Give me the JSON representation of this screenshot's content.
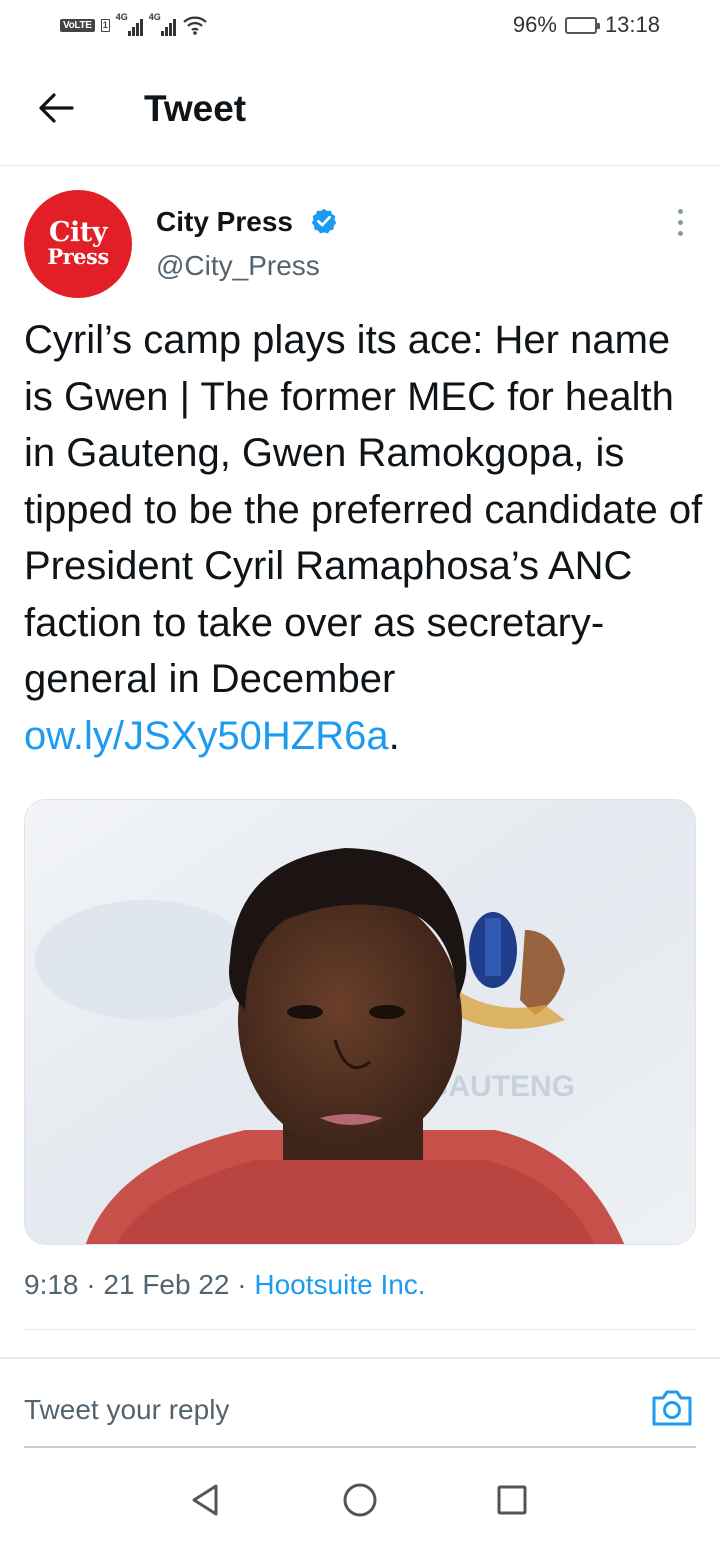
{
  "status_bar": {
    "volte": "VoLTE",
    "sim": "1",
    "network1": "4G",
    "network2": "4G",
    "battery_percent": "96%",
    "battery_level": 0.96,
    "time": "13:18",
    "icons": [
      "signal-icon",
      "signal-icon",
      "wifi-icon",
      "battery-icon"
    ]
  },
  "header": {
    "title": "Tweet",
    "back_icon": "arrow-left-icon"
  },
  "tweet": {
    "author": {
      "name": "City Press",
      "handle": "@City_Press",
      "avatar_line1": "City",
      "avatar_line2": "Press",
      "verified": true
    },
    "text": "Cyril’s camp plays its ace: Her name is Gwen | The former MEC for health in Gauteng, Gwen Ramokgopa, is tipped to be the preferred candidate of President Cyril Ramaphosa’s ANC faction to take over as secretary-general in December ",
    "link": "ow.ly/JSXy50HZR6a",
    "text_end": ".",
    "time": "9:18",
    "separator": "·",
    "date": "21 Feb 22",
    "source": "Hootsuite Inc."
  },
  "reply": {
    "placeholder": "Tweet your reply",
    "camera_icon": "camera-icon"
  },
  "nav": {
    "icons": [
      "back-triangle-icon",
      "home-circle-icon",
      "recents-square-icon"
    ]
  },
  "colors": {
    "link": "#1d9bf0",
    "avatar_bg": "#e21f26",
    "text_primary": "#0f1419",
    "text_secondary": "#536471"
  }
}
